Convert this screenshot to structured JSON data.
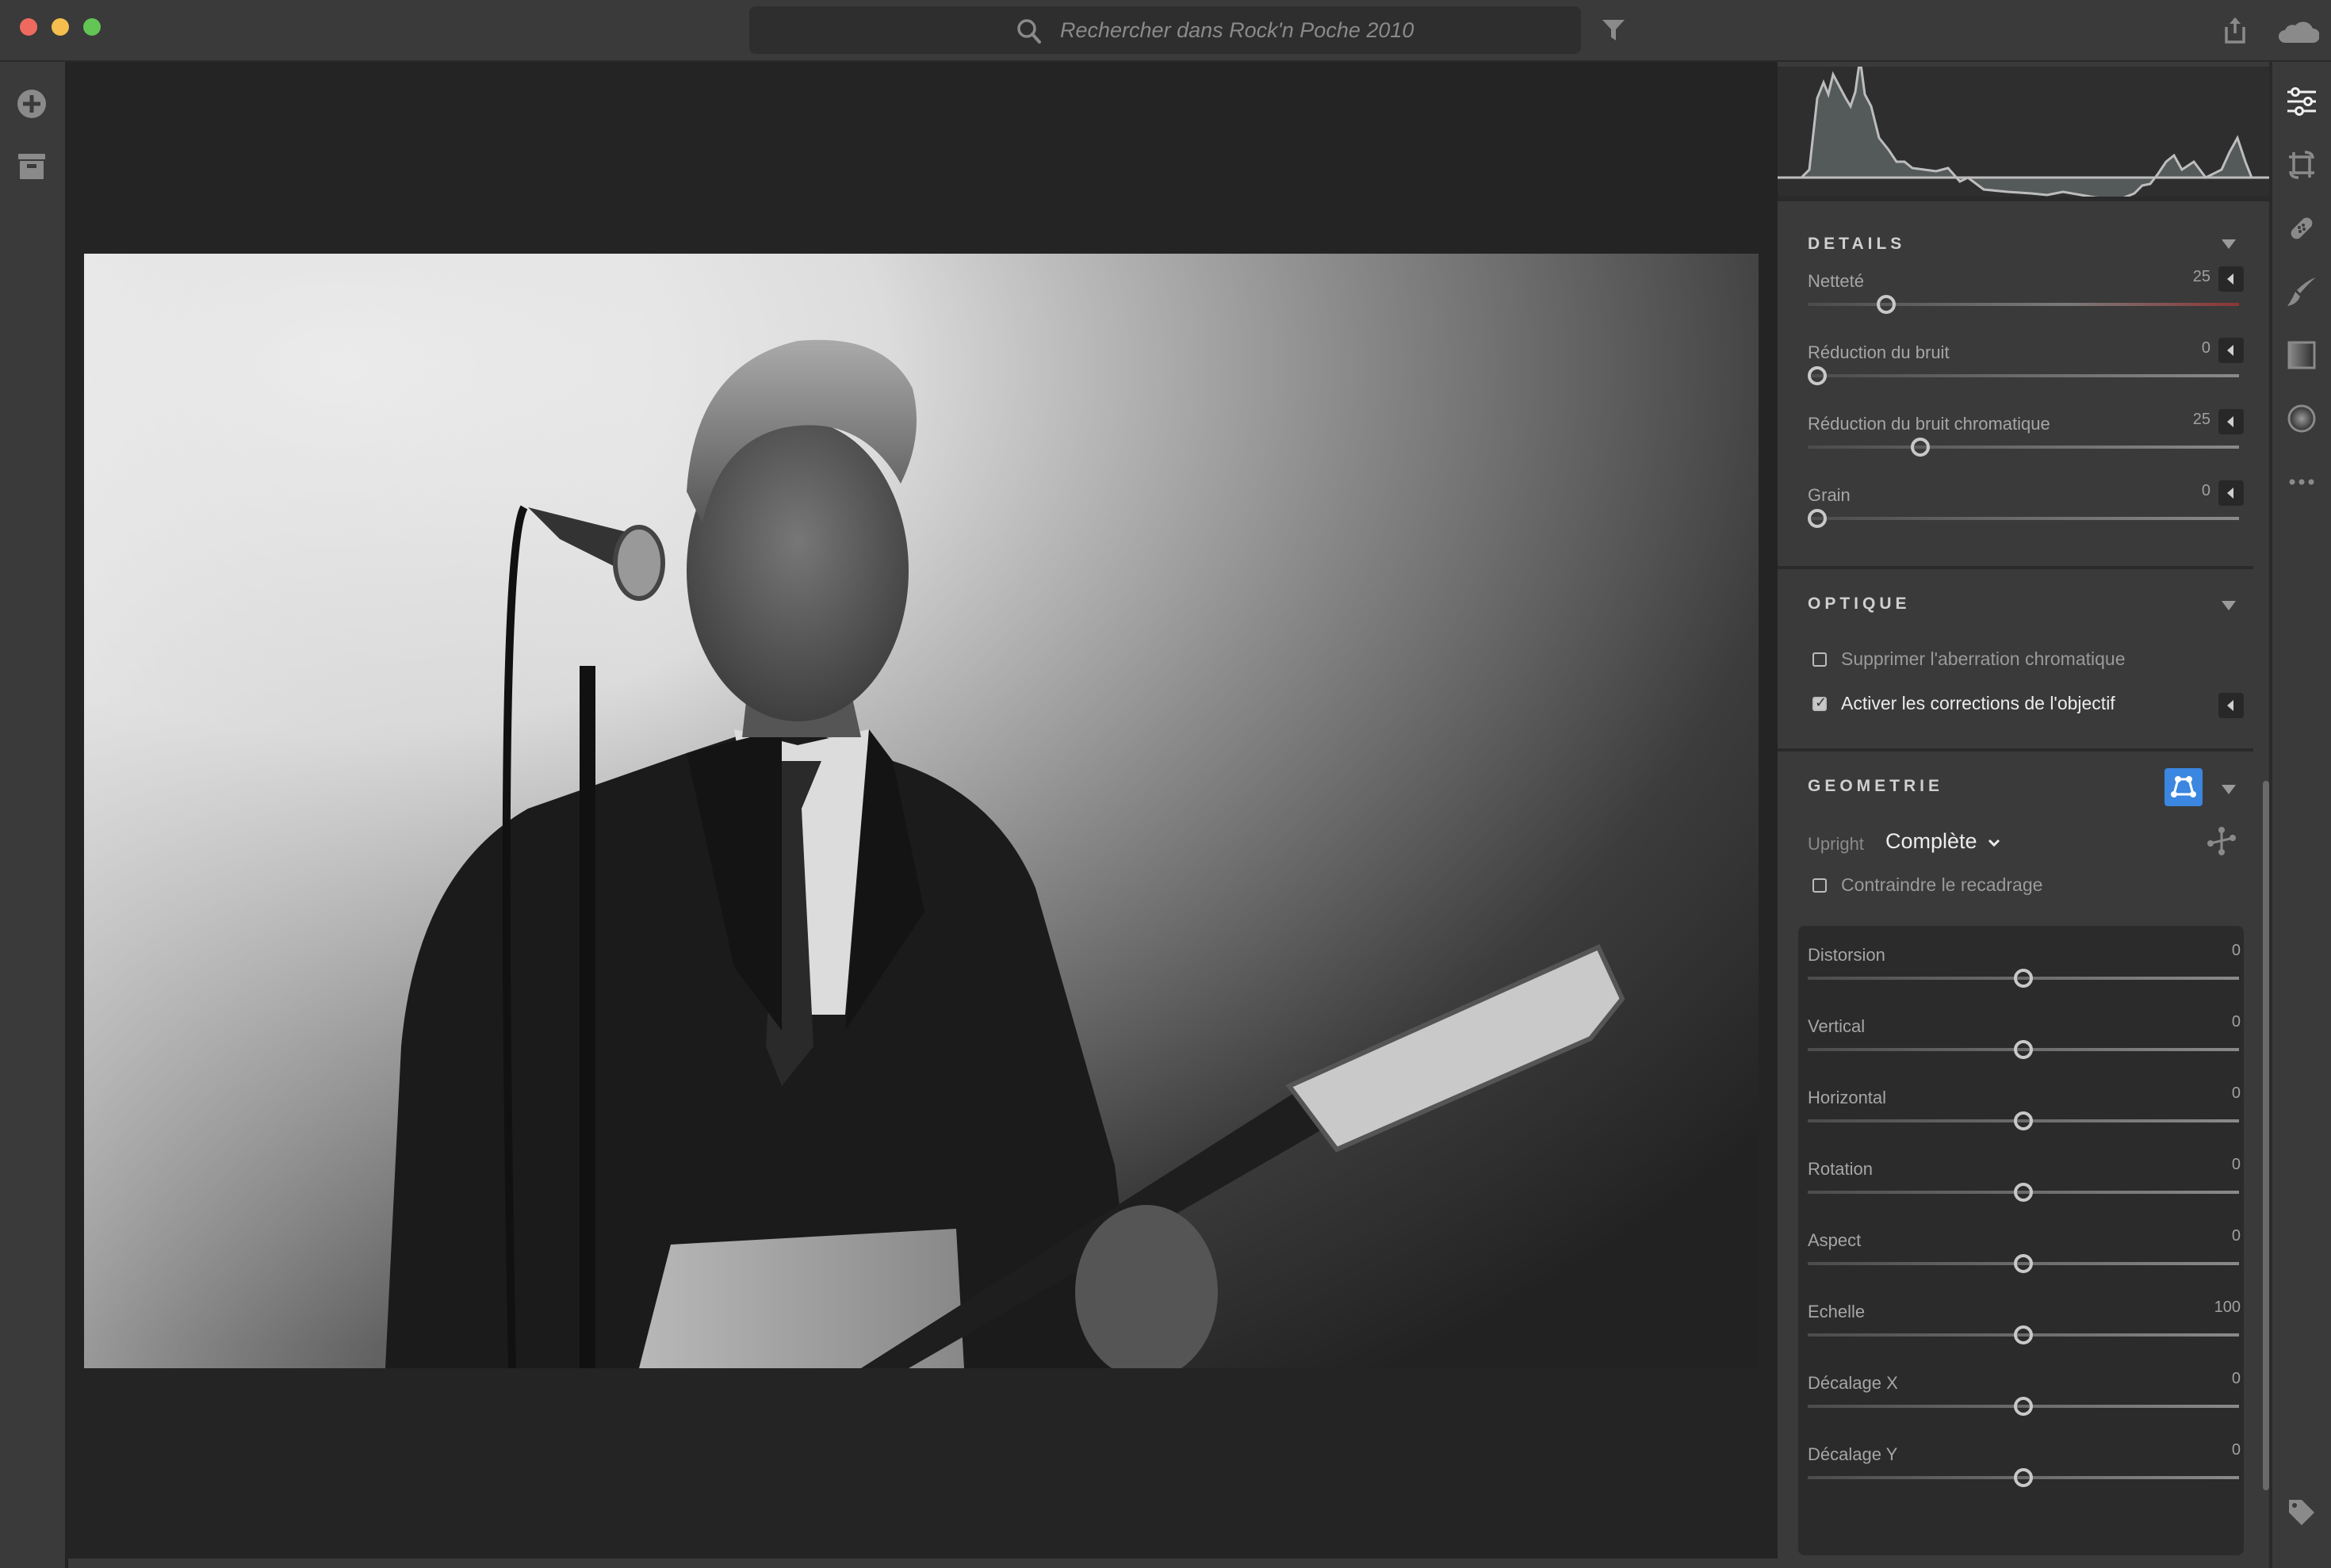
{
  "titlebar": {
    "window_controls": [
      "close",
      "minimize",
      "zoom"
    ],
    "search_placeholder": "Rechercher dans Rock'n Poche 2010",
    "icons": {
      "search": "search-icon",
      "filter": "filter-icon",
      "share": "share-icon",
      "cloud": "cloud-icon"
    }
  },
  "left_sidebar": {
    "icons": [
      "add-photos-icon",
      "archive-icon"
    ]
  },
  "photo": {
    "description": "Black and white concert photo: singer in suit with guitar at microphone"
  },
  "right_rail": {
    "icons": [
      "edit-sliders-icon",
      "crop-rotate-icon",
      "healing-icon",
      "brush-icon",
      "linear-gradient-icon",
      "radial-gradient-icon",
      "more-icon",
      "tag-icon"
    ],
    "active": "edit-sliders-icon"
  },
  "panel": {
    "details": {
      "title": "DETAILS",
      "sliders": [
        {
          "label": "Netteté",
          "value": "25",
          "fraction": 0.167,
          "has_reset": true,
          "track": "red"
        },
        {
          "label": "Réduction du bruit",
          "value": "0",
          "fraction": 0.0,
          "has_reset": true
        },
        {
          "label": "Réduction du bruit chromatique",
          "value": "25",
          "fraction": 0.25,
          "has_reset": true
        },
        {
          "label": "Grain",
          "value": "0",
          "fraction": 0.0,
          "has_reset": true
        }
      ]
    },
    "optique": {
      "title": "OPTIQUE",
      "checkboxes": [
        {
          "label": "Supprimer l'aberration chromatique",
          "checked": false
        },
        {
          "label": "Activer les corrections de l'objectif",
          "checked": true
        }
      ]
    },
    "geometrie": {
      "title": "GEOMETRIE",
      "upright_label": "Upright",
      "upright_value": "Complète",
      "constrain_label": "Contraindre le recadrage",
      "constrain_checked": false,
      "accent_color": "#3a86e0",
      "sliders": [
        {
          "label": "Distorsion",
          "value": "0",
          "fraction": 0.5
        },
        {
          "label": "Vertical",
          "value": "0",
          "fraction": 0.5
        },
        {
          "label": "Horizontal",
          "value": "0",
          "fraction": 0.5
        },
        {
          "label": "Rotation",
          "value": "0",
          "fraction": 0.5
        },
        {
          "label": "Aspect",
          "value": "0",
          "fraction": 0.5
        },
        {
          "label": "Echelle",
          "value": "100",
          "fraction": 0.5
        },
        {
          "label": "Décalage X",
          "value": "0",
          "fraction": 0.5
        },
        {
          "label": "Décalage Y",
          "value": "0",
          "fraction": 0.5
        }
      ]
    }
  },
  "colors": {
    "close": "#ee6a5f",
    "minimize": "#f5be4f",
    "zoom": "#62c554",
    "panel_bg": "#3a3a3a",
    "canvas_bg": "#242424",
    "accent": "#3a86e0"
  }
}
